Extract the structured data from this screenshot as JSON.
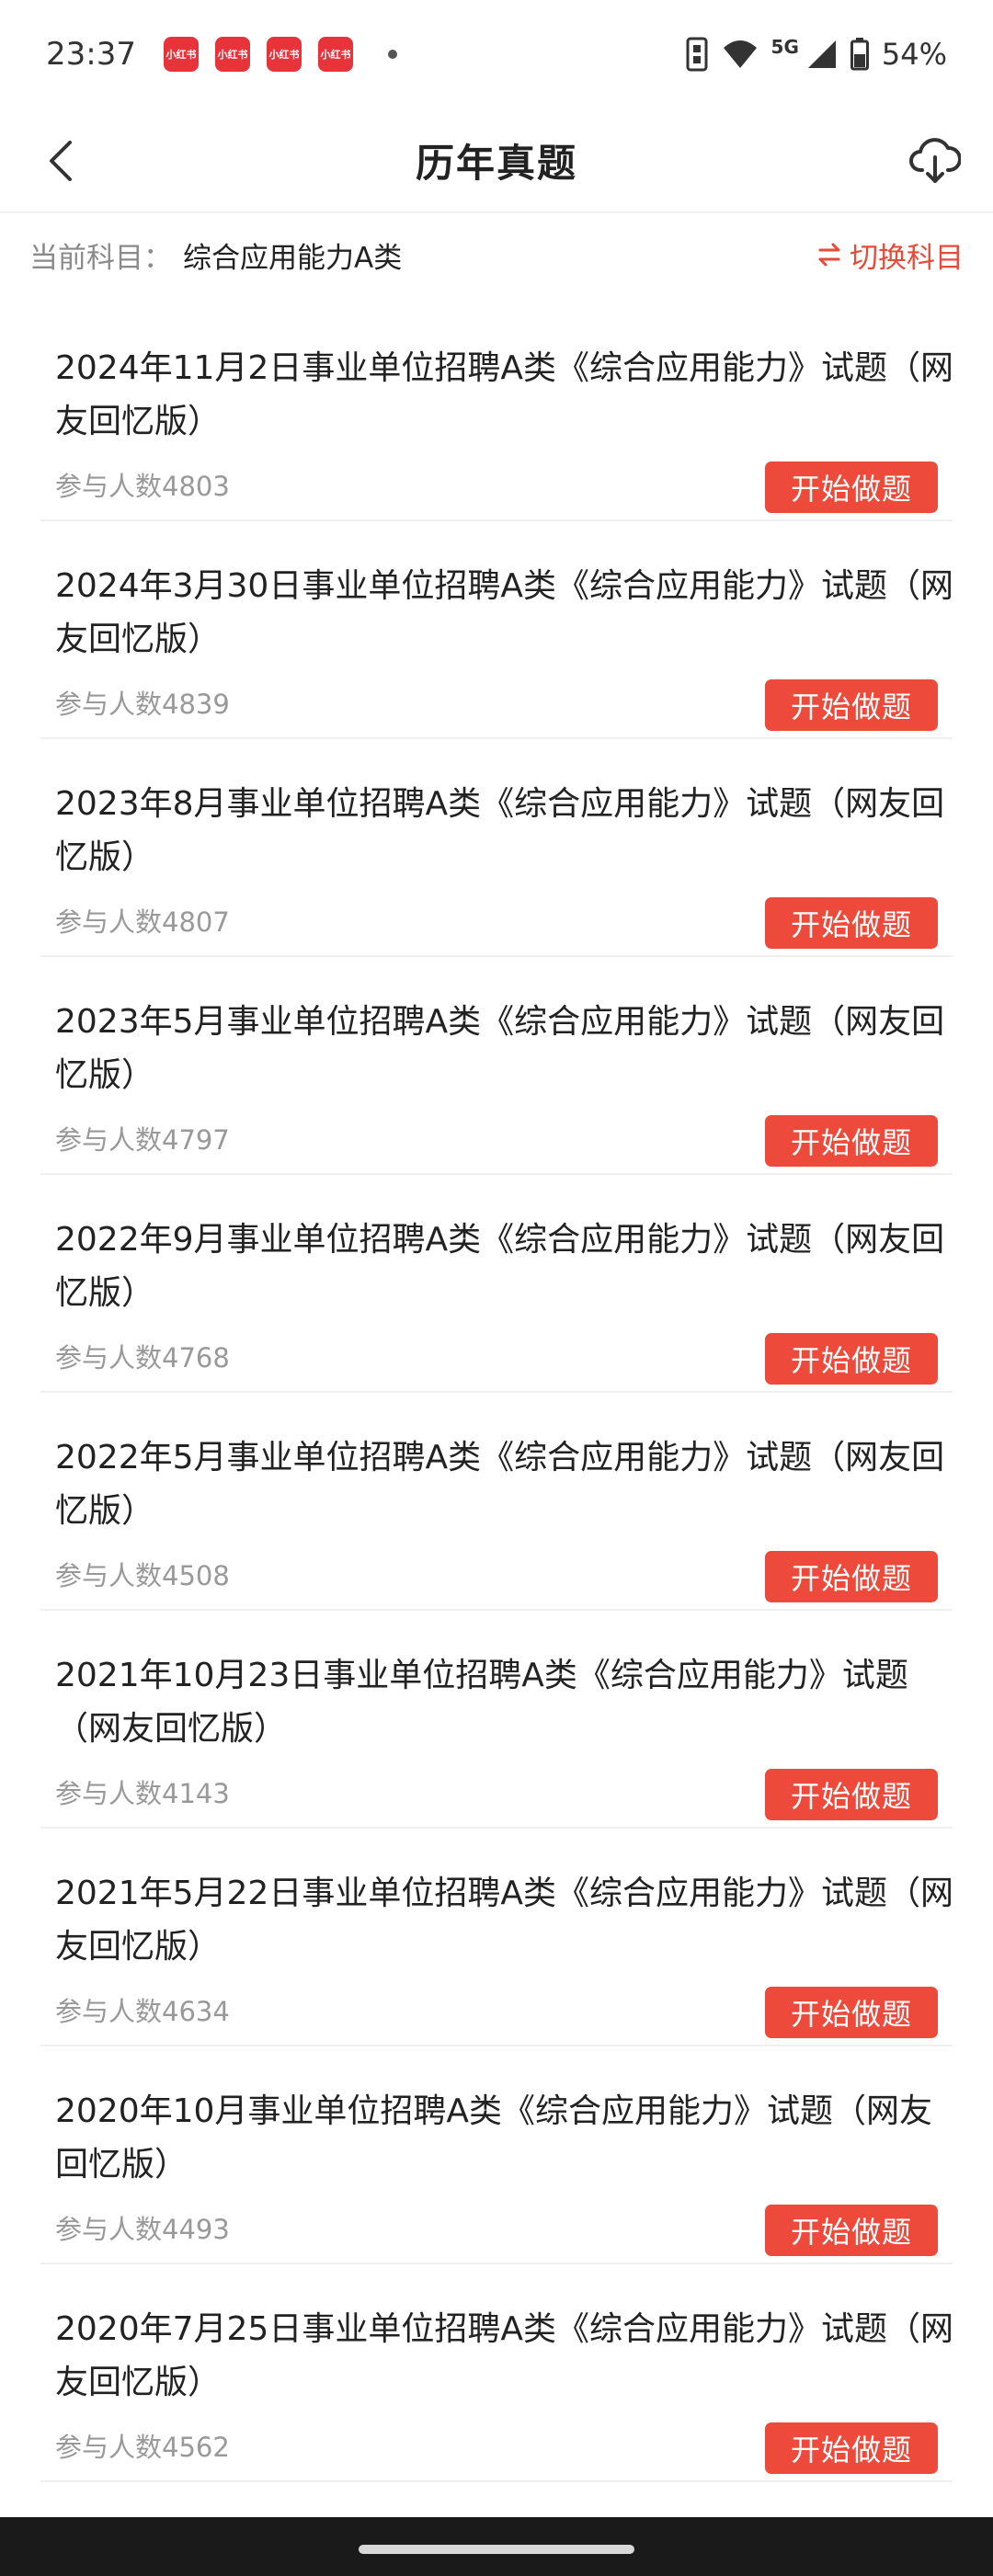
{
  "status_bar": {
    "time": "23:37",
    "notification_label": "小红书",
    "network": "5G",
    "battery": "54%"
  },
  "nav": {
    "title": "历年真题",
    "back_icon": "chevron-left-icon",
    "download_icon": "cloud-download-icon"
  },
  "subject": {
    "label": "当前科目：",
    "value": "综合应用能力A类",
    "switch_label": "切换科目",
    "accent_color": "#e84a3a"
  },
  "exams": [
    {
      "title": "2024年11月2日事业单位招聘A类《综合应用能力》试题（网友回忆版）",
      "count": "参与人数4803",
      "button": "开始做题"
    },
    {
      "title": "2024年3月30日事业单位招聘A类《综合应用能力》试题（网友回忆版）",
      "count": "参与人数4839",
      "button": "开始做题"
    },
    {
      "title": "2023年8月事业单位招聘A类《综合应用能力》试题（网友回忆版）",
      "count": "参与人数4807",
      "button": "开始做题"
    },
    {
      "title": "2023年5月事业单位招聘A类《综合应用能力》试题（网友回忆版）",
      "count": "参与人数4797",
      "button": "开始做题"
    },
    {
      "title": "2022年9月事业单位招聘A类《综合应用能力》试题（网友回忆版）",
      "count": "参与人数4768",
      "button": "开始做题"
    },
    {
      "title": "2022年5月事业单位招聘A类《综合应用能力》试题（网友回忆版）",
      "count": "参与人数4508",
      "button": "开始做题"
    },
    {
      "title": "2021年10月23日事业单位招聘A类《综合应用能力》试题（网友回忆版）",
      "count": "参与人数4143",
      "button": "开始做题"
    },
    {
      "title": "2021年5月22日事业单位招聘A类《综合应用能力》试题（网友回忆版）",
      "count": "参与人数4634",
      "button": "开始做题"
    },
    {
      "title": "2020年10月事业单位招聘A类《综合应用能力》试题（网友回忆版）",
      "count": "参与人数4493",
      "button": "开始做题"
    },
    {
      "title": "2020年7月25日事业单位招聘A类《综合应用能力》试题（网友回忆版）",
      "count": "参与人数4562",
      "button": "开始做题"
    }
  ]
}
